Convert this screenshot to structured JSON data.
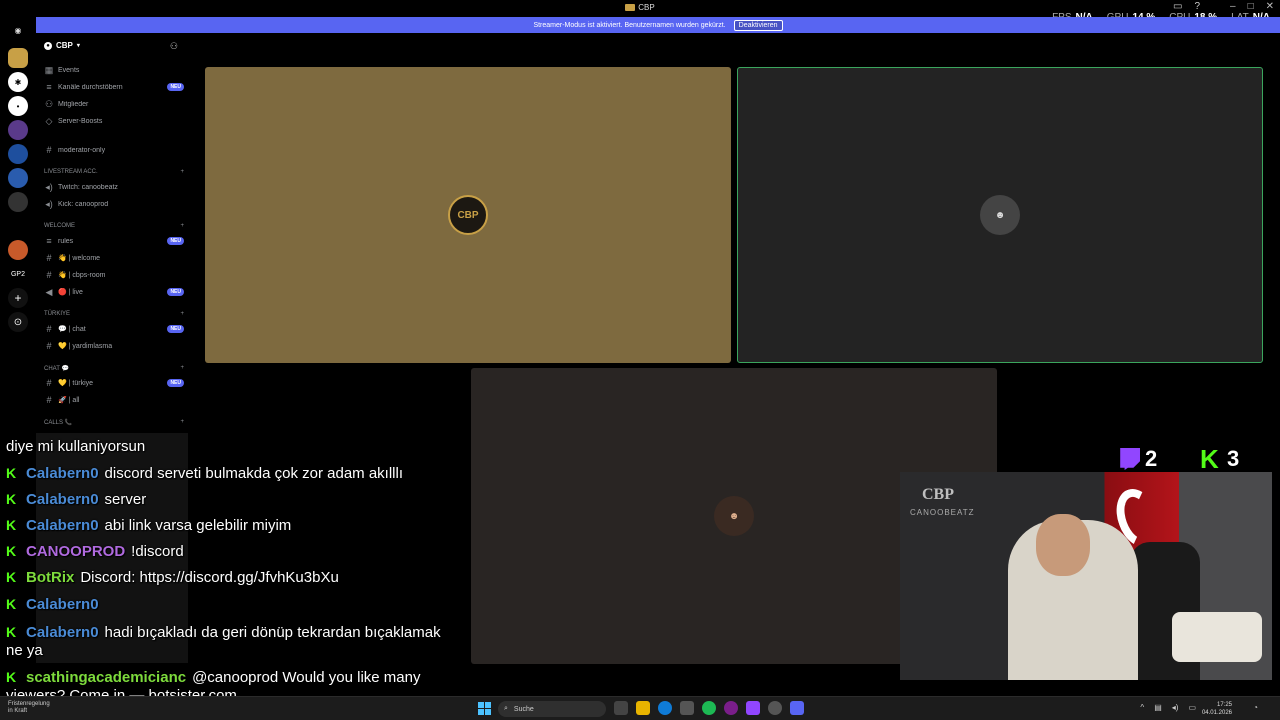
{
  "window": {
    "title": "CBP"
  },
  "banner": {
    "text": "Streamer-Modus ist aktiviert. Benutzernamen wurden gekürzt.",
    "button": "Deaktivieren"
  },
  "perf": [
    {
      "label": "FPS",
      "value": "N/A"
    },
    {
      "label": "GPU",
      "value": "14 %"
    },
    {
      "label": "CPU",
      "value": "18 %"
    },
    {
      "label": "LAT",
      "value": "N/A"
    }
  ],
  "rail": {
    "gp2_label": "GP2"
  },
  "sidebar": {
    "guild_name": "CBP",
    "items": [
      {
        "label": "Events",
        "badge": ""
      },
      {
        "label": "Kanäle durchstöbern",
        "badge": "NEU"
      },
      {
        "label": "Mitglieder",
        "badge": ""
      },
      {
        "label": "Server-Boosts",
        "badge": ""
      },
      {
        "label": "moderator-only",
        "badge": ""
      }
    ],
    "categories": [
      {
        "name": "LIVESTREAM ACC.",
        "channels": [
          {
            "label": "Twitch: canoobeatz",
            "badge": ""
          },
          {
            "label": "Kick: canooprod",
            "badge": ""
          }
        ]
      },
      {
        "name": "WELCOME",
        "channels": [
          {
            "label": "rules",
            "badge": "NEU"
          },
          {
            "label": "👋 | welcome",
            "badge": ""
          },
          {
            "label": "👋 | cbps-room",
            "badge": ""
          },
          {
            "label": "🔴 | live",
            "badge": "NEU"
          }
        ]
      },
      {
        "name": "TÜRKIYE",
        "channels": [
          {
            "label": "💬 | chat",
            "badge": "NEU"
          },
          {
            "label": "💛 | yardimlasma",
            "badge": ""
          }
        ]
      },
      {
        "name": "CHAT 💬",
        "channels": [
          {
            "label": "💛 | türkiye",
            "badge": "NEU"
          },
          {
            "label": "🚀 | all",
            "badge": ""
          }
        ]
      },
      {
        "name": "CALLS 📞",
        "channels": []
      }
    ]
  },
  "video": {
    "tile1_avatar": "CBP",
    "tile2_avatar": "",
    "tile3_avatar": ""
  },
  "viewers": {
    "twitch": "2",
    "kick": "3"
  },
  "webcam": {
    "sign_big": "CBP",
    "sign_small": "CANOOBEATZ"
  },
  "chat": [
    {
      "user": "",
      "text": "diye mi kullaniyorsun",
      "color": "#ffffff"
    },
    {
      "user": "Calabern0",
      "text": "discord serveti bulmakda çok zor adam akılllı",
      "color": "#4a8bd6"
    },
    {
      "user": "Calabern0",
      "text": "server",
      "color": "#4a8bd6"
    },
    {
      "user": "Calabern0",
      "text": "abi link varsa gelebilir miyim",
      "color": "#4a8bd6"
    },
    {
      "user": "CANOOPROD",
      "text": "!discord",
      "color": "#b06adf"
    },
    {
      "user": "BotRix",
      "text": "Discord: https://discord.gg/JfvhKu3bXu",
      "color": "#7ddb3c"
    },
    {
      "user": "Calabern0",
      "text": "",
      "color": "#4a8bd6"
    },
    {
      "user": "Calabern0",
      "text": "hadi bıçakladı da geri dönüp tekrardan bıçaklamak",
      "color": "#4a8bd6"
    },
    {
      "user": "",
      "text": "ne ya",
      "color": "#ffffff"
    },
    {
      "user": "scathingacademicianc",
      "text": "@canooprod Would you like many",
      "color": "#7ddb3c"
    },
    {
      "user": "",
      "text": "viewers? Come in — botsister.com",
      "color": "#ffffff"
    }
  ],
  "taskbar": {
    "left_line1": "Fristenregelung",
    "left_line2": "in Kraft",
    "search": "Suche",
    "time": "17:25",
    "date": "04.01.2026"
  },
  "colors": {
    "banner": "#5865f2",
    "kick": "#53fc18",
    "twitch": "#9146ff",
    "speaking": "#3ba55d"
  }
}
